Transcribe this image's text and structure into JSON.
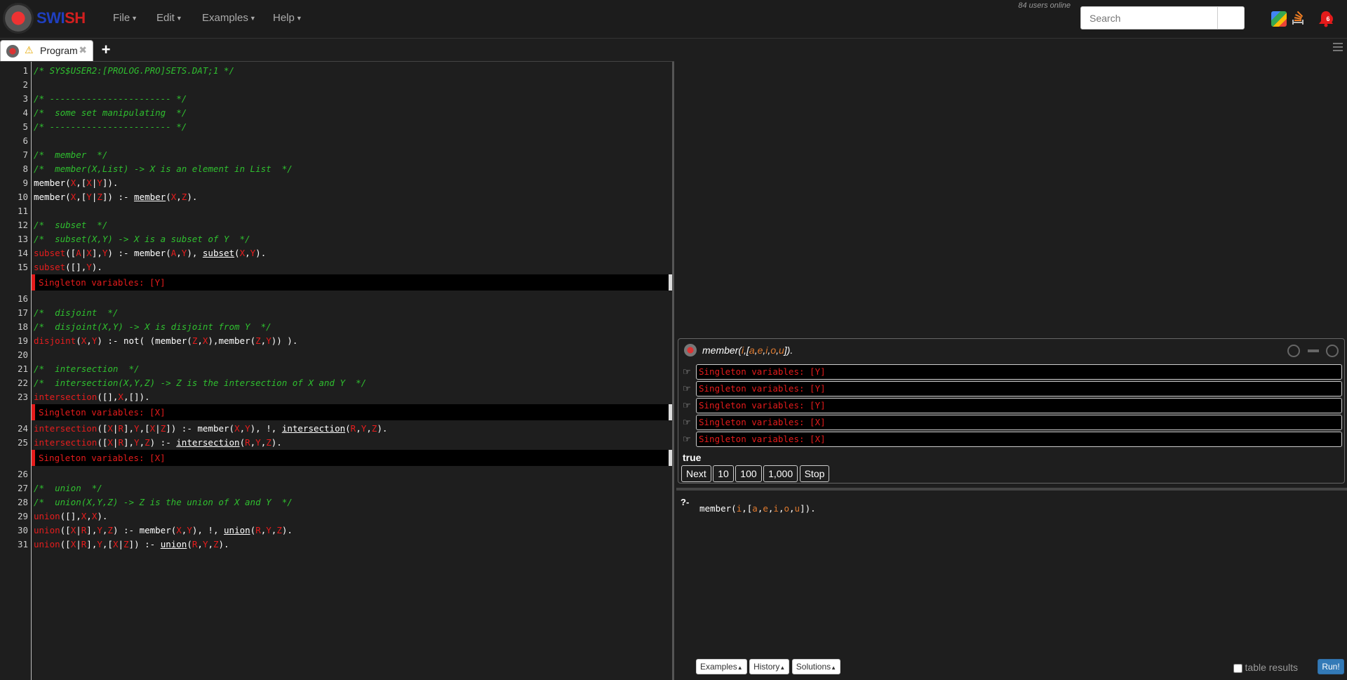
{
  "navbar": {
    "brand_a": "SWI",
    "brand_b": "SH",
    "menus": [
      {
        "label": "File"
      },
      {
        "label": "Edit"
      },
      {
        "label": "Examples"
      },
      {
        "label": "Help"
      }
    ],
    "users_online": "84 users online",
    "search_placeholder": "Search",
    "notification_count": "6",
    "colors": {
      "brand_blue": "#1f3fbf",
      "brand_red": "#d21f1f",
      "badge": "#e41b1b"
    }
  },
  "editor": {
    "tab": {
      "label": "Program",
      "warn_icon": "⚠",
      "close_icon": "✖"
    },
    "add_tab_icon": "+"
  },
  "answer": {
    "query_label": "member(i,[a,e,i,o,u]).",
    "warnings": [
      "Singleton variables: [Y]",
      "Singleton variables: [Y]",
      "Singleton variables: [Y]",
      "Singleton variables: [X]",
      "Singleton variables: [X]"
    ],
    "result": "true",
    "buttons": [
      "Next",
      "10",
      "100",
      "1,000",
      "Stop"
    ]
  },
  "query": {
    "prompt": "?-",
    "text": "member(i,[a,e,i,o,u]).",
    "buttons": [
      "Examples",
      "History",
      "Solutions"
    ],
    "table_results": "table results",
    "run": "Run!"
  }
}
